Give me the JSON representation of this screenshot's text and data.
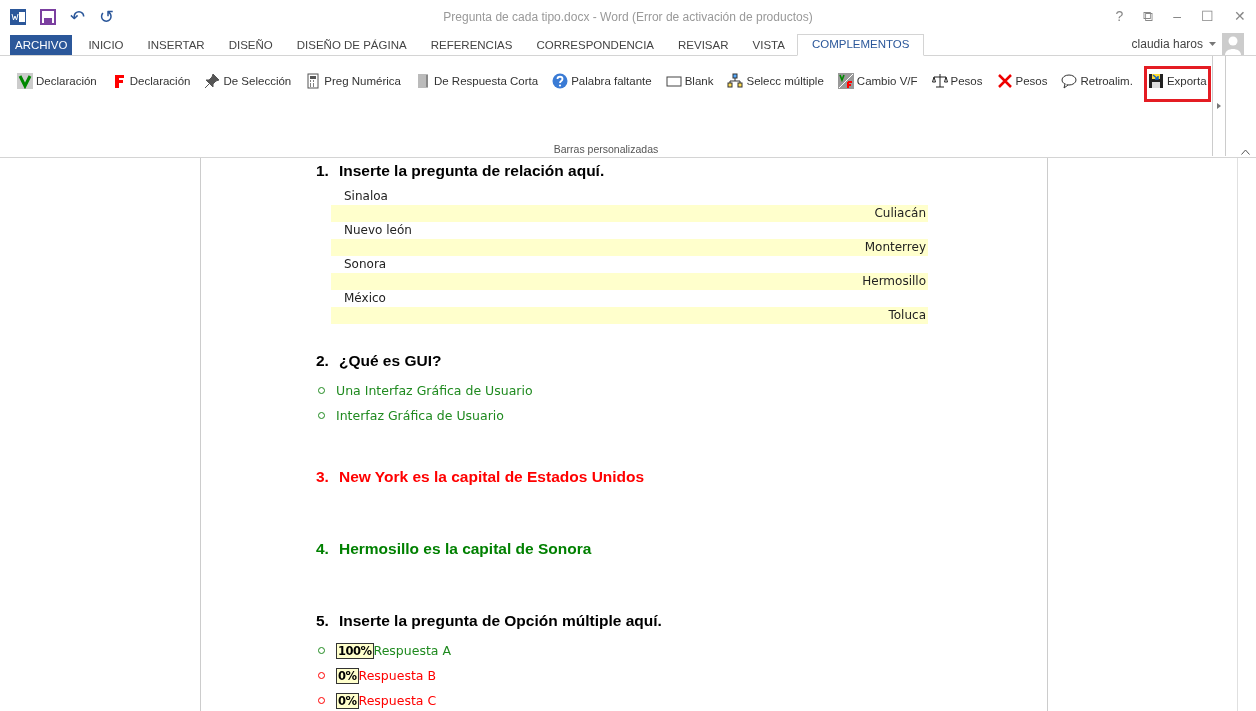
{
  "window": {
    "title": "Pregunta de cada tipo.docx - Word (Error de activación de productos)",
    "controls": [
      "?",
      "⧉",
      "–",
      "☐",
      "✕"
    ]
  },
  "quick_access": [
    "↶",
    "↺"
  ],
  "tabs": [
    {
      "label": "ARCHIVO",
      "kind": "file",
      "selected": false
    },
    {
      "label": "INICIO",
      "kind": "tab",
      "selected": false
    },
    {
      "label": "INSERTAR",
      "kind": "tab",
      "selected": false
    },
    {
      "label": "DISEÑO",
      "kind": "tab",
      "selected": false
    },
    {
      "label": "DISEÑO DE PÁGINA",
      "kind": "tab",
      "selected": false
    },
    {
      "label": "REFERENCIAS",
      "kind": "tab",
      "selected": false
    },
    {
      "label": "CORRESPONDENCIA",
      "kind": "tab",
      "selected": false
    },
    {
      "label": "REVISAR",
      "kind": "tab",
      "selected": false
    },
    {
      "label": "VISTA",
      "kind": "tab",
      "selected": false
    },
    {
      "label": "COMPLEMENTOS",
      "kind": "tab",
      "selected": true
    }
  ],
  "user": {
    "name": "claudia haros"
  },
  "toolbar": {
    "group_label": "Barras personalizadas",
    "buttons": [
      {
        "label": "Declaración",
        "highlighted": false
      },
      {
        "label": "Declaración",
        "highlighted": false
      },
      {
        "label": "De Selección",
        "highlighted": false
      },
      {
        "label": "Preg Numérica",
        "highlighted": false
      },
      {
        "label": "De Respuesta Corta",
        "highlighted": false
      },
      {
        "label": "Palabra faltante",
        "highlighted": false
      },
      {
        "label": "Blank",
        "highlighted": false
      },
      {
        "label": "Selecc múltiple",
        "highlighted": false
      },
      {
        "label": "Cambio V/F",
        "highlighted": false
      },
      {
        "label": "Pesos",
        "highlighted": false
      },
      {
        "label": "Pesos",
        "highlighted": false
      },
      {
        "label": "Retroalim.",
        "highlighted": false
      },
      {
        "label": "Exporta",
        "highlighted": true
      }
    ]
  },
  "document": {
    "questions": [
      {
        "number": "1.",
        "text": "Inserte la pregunta de relación aquí.",
        "color": "#000000",
        "kind": "matching",
        "pairs": [
          {
            "left": "Sinaloa",
            "right": "Culiacán"
          },
          {
            "left": "Nuevo león",
            "right": "Monterrey"
          },
          {
            "left": "Sonora",
            "right": "Hermosillo"
          },
          {
            "left": "México",
            "right": "Toluca"
          }
        ]
      },
      {
        "number": "2.",
        "text": "¿Qué es GUI?",
        "color": "#000000",
        "kind": "short",
        "options": [
          {
            "text": "Una Interfaz Gráfica de Usuario",
            "correct": true
          },
          {
            "text": "Interfaz Gráfica de Usuario",
            "correct": true
          }
        ]
      },
      {
        "number": "3.",
        "text": "New York es la capital de Estados Unidos",
        "color": "#ff0000",
        "kind": "truefalse"
      },
      {
        "number": "4.",
        "text": "Hermosillo es la capital de Sonora",
        "color": "#008000",
        "kind": "truefalse"
      },
      {
        "number": "5.",
        "text": "Inserte la pregunta de Opción múltiple aquí.",
        "color": "#000000",
        "kind": "multiple",
        "options": [
          {
            "weight": "100%",
            "text": "Respuesta A",
            "correct": true
          },
          {
            "weight": "0%",
            "text": "Respuesta B",
            "correct": false
          },
          {
            "weight": "0%",
            "text": "Respuesta C",
            "correct": false
          }
        ]
      }
    ]
  }
}
